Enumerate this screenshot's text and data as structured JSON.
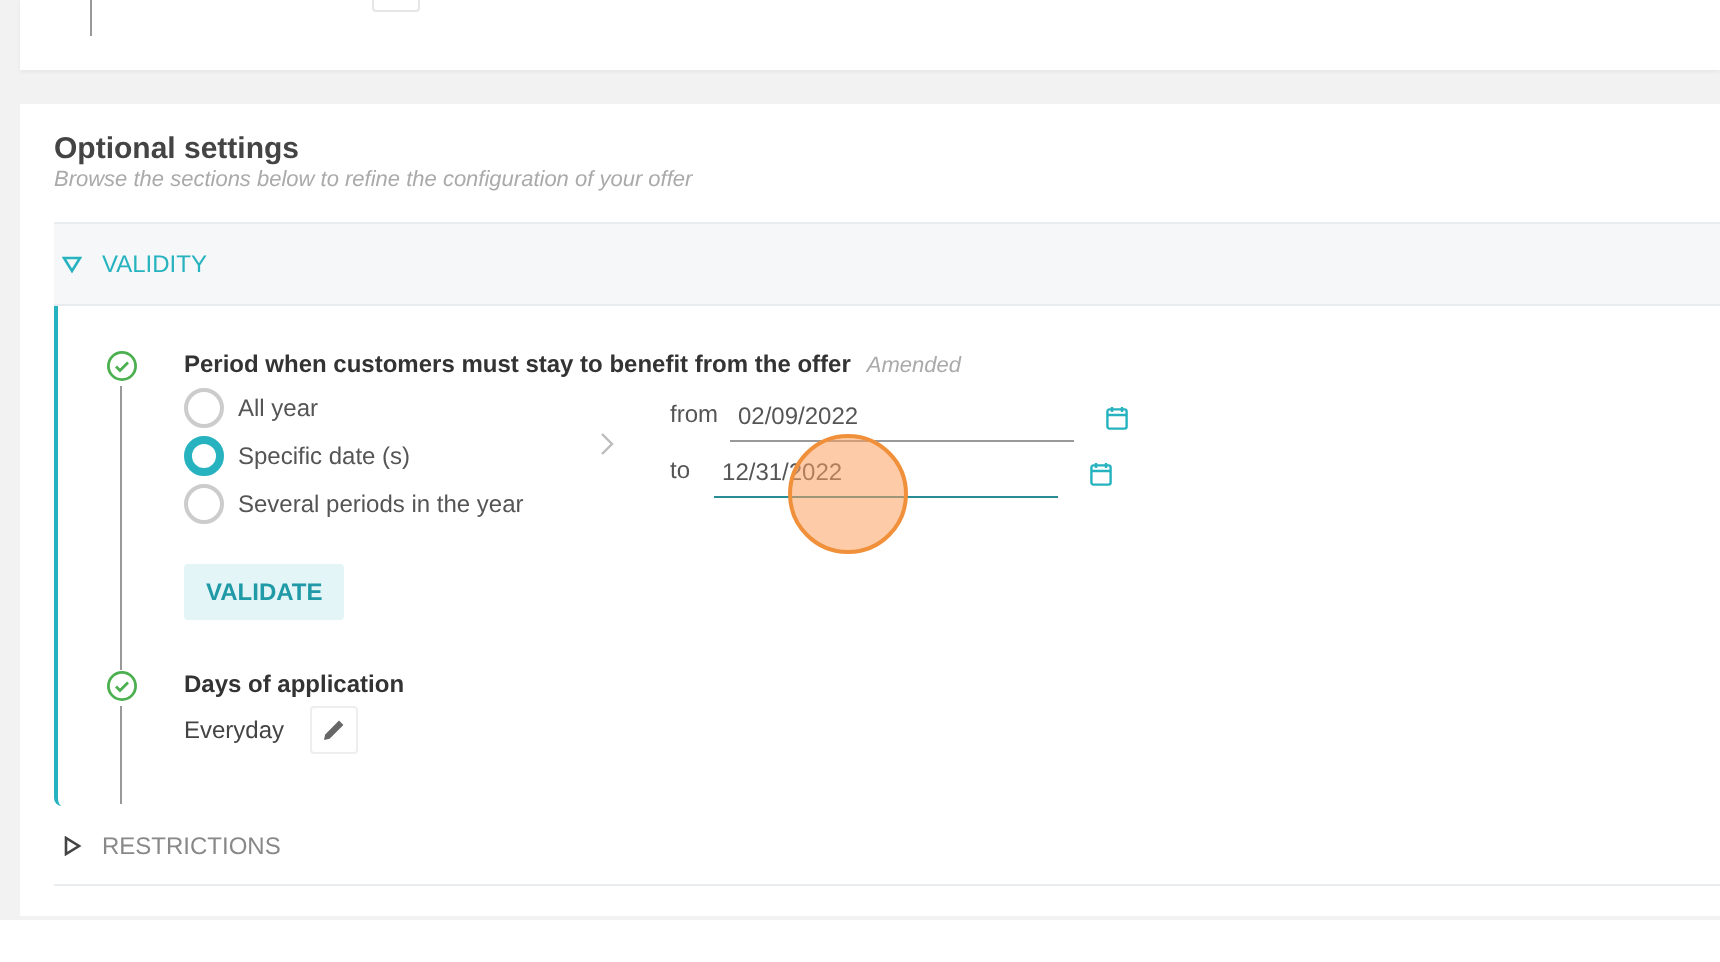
{
  "section": {
    "title": "Optional settings",
    "subtitle": "Browse the sections below to refine the configuration of your offer"
  },
  "groups": [
    {
      "label": "VALIDITY",
      "expanded": true,
      "steps": [
        {
          "kind": "period",
          "done": true,
          "title": "Period when customers must stay to benefit from the offer",
          "badge": "Amended",
          "options": [
            {
              "label": "All year",
              "selected": false
            },
            {
              "label": "Specific date (s)",
              "selected": true
            },
            {
              "label": "Several periods in the year",
              "selected": false
            }
          ],
          "dates": [
            {
              "label": "from",
              "value": "02/09/2022",
              "focused": false,
              "clicked": false
            },
            {
              "label": "to",
              "value": "12/31/2022",
              "focused": true,
              "clicked": true
            }
          ],
          "button": "VALIDATE"
        },
        {
          "kind": "summary",
          "done": true,
          "title": "Days of application",
          "value": "Everyday"
        }
      ]
    },
    {
      "label": "RESTRICTIONS",
      "expanded": false
    }
  ]
}
